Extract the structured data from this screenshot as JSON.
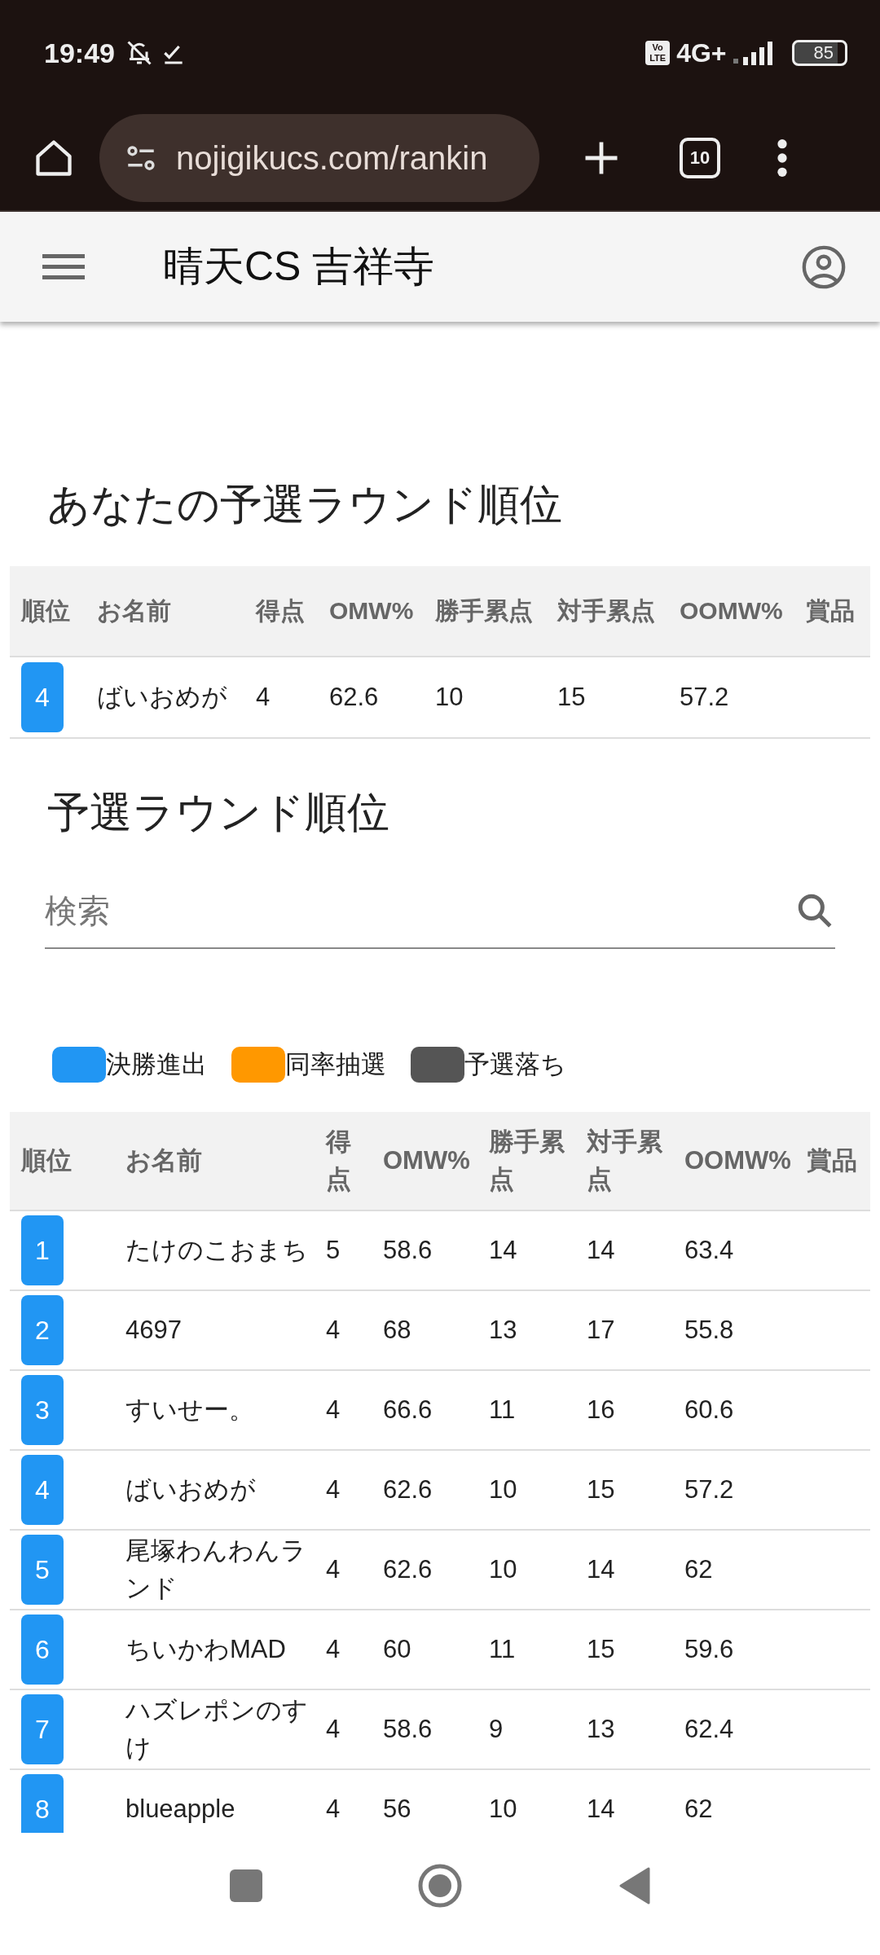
{
  "status_bar": {
    "time": "19:49",
    "volte": "Vo LTE",
    "network": "4G+",
    "battery": "85"
  },
  "browser": {
    "url": "nojigikucs.com/rankin",
    "tab_count": "10"
  },
  "app_bar": {
    "title": "晴天CS 吉祥寺"
  },
  "my_ranking": {
    "title": "あなたの予選ラウンド順位",
    "columns": [
      "順位",
      "お名前",
      "得点",
      "OMW%",
      "勝手累点",
      "対手累点",
      "OOMW%",
      "賞品"
    ],
    "rows": [
      {
        "rank": "4",
        "name": "ばいおめが",
        "points": "4",
        "omw": "62.6",
        "win_total": "10",
        "opp_total": "15",
        "oomw": "57.2",
        "color": "#2196f3"
      }
    ]
  },
  "ranking": {
    "title": "予選ラウンド順位",
    "search": {
      "placeholder": "検索"
    },
    "legend": [
      {
        "label": "決勝進出",
        "color": "#2196f3"
      },
      {
        "label": "同率抽選",
        "color": "#ff9800"
      },
      {
        "label": "予選落ち",
        "color": "#555555"
      }
    ],
    "columns": [
      "順位",
      "お名前",
      "得点",
      "OMW%",
      "勝手累点",
      "対手累点",
      "OOMW%",
      "賞品"
    ],
    "rows": [
      {
        "rank": "1",
        "name": "たけのこおまち",
        "points": "5",
        "omw": "58.6",
        "win_total": "14",
        "opp_total": "14",
        "oomw": "63.4",
        "color": "#2196f3"
      },
      {
        "rank": "2",
        "name": "4697",
        "points": "4",
        "omw": "68",
        "win_total": "13",
        "opp_total": "17",
        "oomw": "55.8",
        "color": "#2196f3"
      },
      {
        "rank": "3",
        "name": "すいせー。",
        "points": "4",
        "omw": "66.6",
        "win_total": "11",
        "opp_total": "16",
        "oomw": "60.6",
        "color": "#2196f3"
      },
      {
        "rank": "4",
        "name": "ばいおめが",
        "points": "4",
        "omw": "62.6",
        "win_total": "10",
        "opp_total": "15",
        "oomw": "57.2",
        "color": "#2196f3"
      },
      {
        "rank": "5",
        "name": "尾塚わんわんランド",
        "points": "4",
        "omw": "62.6",
        "win_total": "10",
        "opp_total": "14",
        "oomw": "62",
        "color": "#2196f3"
      },
      {
        "rank": "6",
        "name": "ちいかわMAD",
        "points": "4",
        "omw": "60",
        "win_total": "11",
        "opp_total": "15",
        "oomw": "59.6",
        "color": "#2196f3"
      },
      {
        "rank": "7",
        "name": "ハズレポンのすけ",
        "points": "4",
        "omw": "58.6",
        "win_total": "9",
        "opp_total": "13",
        "oomw": "62.4",
        "color": "#2196f3"
      },
      {
        "rank": "8",
        "name": "blueapple",
        "points": "4",
        "omw": "56",
        "win_total": "10",
        "opp_total": "14",
        "oomw": "62",
        "color": "#2196f3"
      }
    ]
  }
}
